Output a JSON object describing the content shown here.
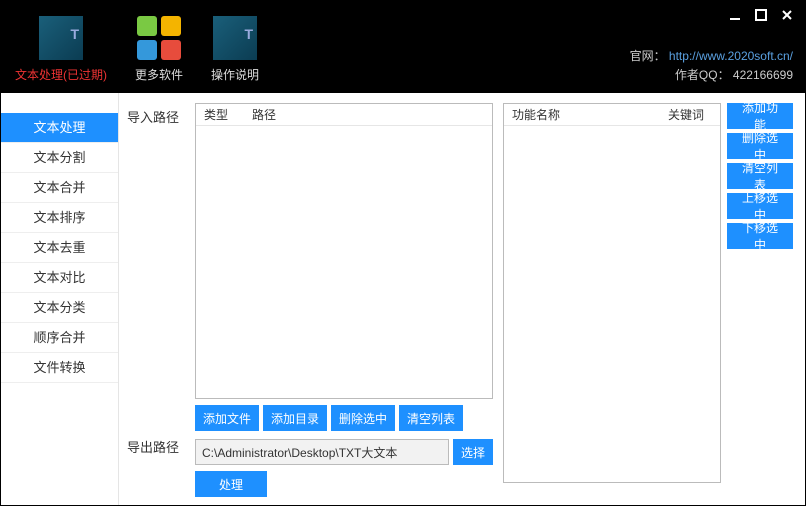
{
  "header": {
    "tabs": [
      {
        "label": "文本处理(已过期)",
        "red": true
      },
      {
        "label": "更多软件",
        "red": false
      },
      {
        "label": "操作说明",
        "red": false
      }
    ],
    "site_label": "官网：",
    "site_url": "http://www.2020soft.cn/",
    "author_label": "作者QQ：",
    "author_qq": "422166699"
  },
  "sidebar": {
    "items": [
      "文本处理",
      "文本分割",
      "文本合并",
      "文本排序",
      "文本去重",
      "文本对比",
      "文本分类",
      "顺序合并",
      "文件转换"
    ],
    "active_index": 0
  },
  "labels": {
    "import_path": "导入路径",
    "export_path": "导出路径",
    "col_type": "类型",
    "col_path": "路径",
    "col_fn": "功能名称",
    "col_kw": "关键词"
  },
  "toolbar": {
    "add_file": "添加文件",
    "add_dir": "添加目录",
    "del_sel": "删除选中",
    "clear": "清空列表",
    "choose": "选择",
    "process": "处理"
  },
  "export_path_value": "C:\\Administrator\\Desktop\\TXT大文本",
  "actions": {
    "add_fn": "添加功能",
    "del_sel": "删除选中",
    "clear": "清空列表",
    "move_up": "上移选中",
    "move_down": "下移选中"
  }
}
